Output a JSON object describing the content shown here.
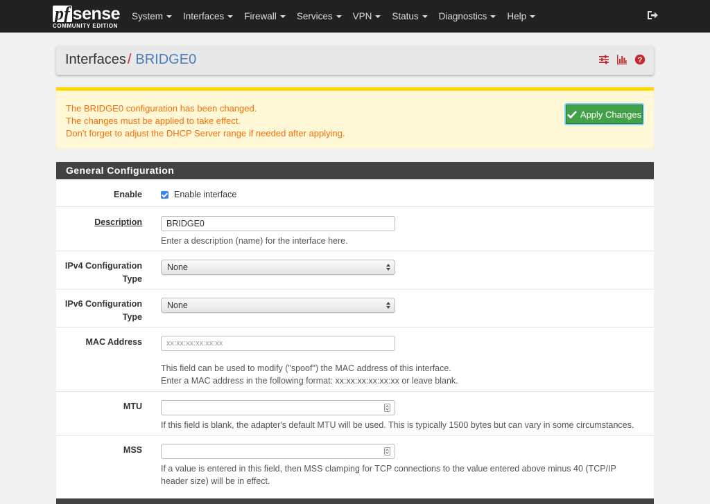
{
  "brand": {
    "logo_pf": "pf",
    "logo_sense": "sense",
    "edition": "COMMUNITY EDITION"
  },
  "nav": [
    {
      "label": "System"
    },
    {
      "label": "Interfaces"
    },
    {
      "label": "Firewall"
    },
    {
      "label": "Services"
    },
    {
      "label": "VPN"
    },
    {
      "label": "Status"
    },
    {
      "label": "Diagnostics"
    },
    {
      "label": "Help"
    }
  ],
  "header": {
    "root": "Interfaces",
    "separator": "/",
    "current": "BRIDGE0"
  },
  "alert": {
    "line1": "The BRIDGE0 configuration has been changed.",
    "line2": "The changes must be applied to take effect.",
    "line3": "Don't forget to adjust the DHCP Server range if needed after applying.",
    "apply_label": "Apply Changes"
  },
  "general": {
    "title": "General Configuration",
    "enable": {
      "label": "Enable",
      "checkbox_label": "Enable interface",
      "checked": true
    },
    "description": {
      "label": "Description",
      "value": "BRIDGE0",
      "help": "Enter a description (name) for the interface here."
    },
    "ipv4": {
      "label_line1": "IPv4 Configuration",
      "label_line2": "Type",
      "selected": "None"
    },
    "ipv6": {
      "label_line1": "IPv6 Configuration",
      "label_line2": "Type",
      "selected": "None"
    },
    "mac": {
      "label": "MAC Address",
      "placeholder": "xx:xx:xx:xx:xx:xx",
      "help1": "This field can be used to modify (\"spoof\") the MAC address of this interface.",
      "help2": "Enter a MAC address in the following format: xx:xx:xx:xx:xx:xx or leave blank."
    },
    "mtu": {
      "label": "MTU",
      "value": "",
      "help": "If this field is blank, the adapter's default MTU will be used. This is typically 1500 bytes but can vary in some circumstances."
    },
    "mss": {
      "label": "MSS",
      "value": "",
      "help1": "If a value is entered in this field, then MSS clamping for TCP connections to the value entered above minus 40 (TCP/IP",
      "help2": "header size) will be in effect."
    }
  },
  "colors": {
    "navbar": "#212121",
    "accent_red": "#c9252c",
    "link_blue": "#4a7ebb",
    "alert_text": "#f46e0b",
    "alert_bar": "#ffd800",
    "apply_green": "#43a047"
  },
  "icons": [
    "logout-icon",
    "sliders-icon",
    "bar-chart-icon",
    "help-icon",
    "check-icon"
  ]
}
